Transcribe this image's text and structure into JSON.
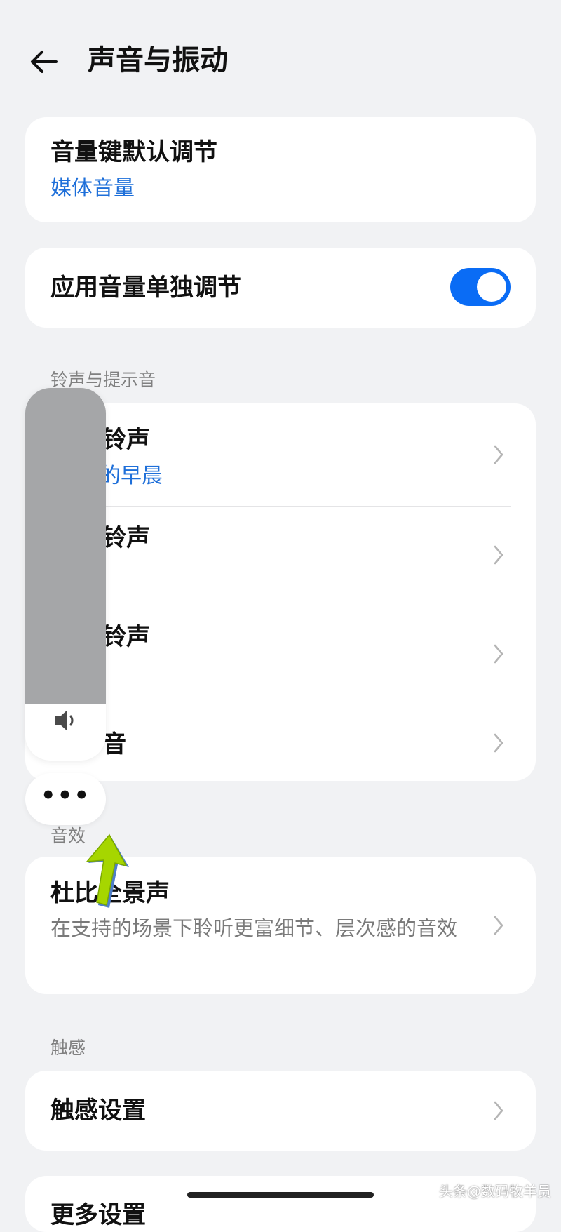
{
  "header": {
    "title": "声音与振动",
    "back_icon": "arrow-left-icon"
  },
  "volume_key": {
    "label": "音量键默认调节",
    "value": "媒体音量"
  },
  "app_volume": {
    "label": "应用音量单独调节",
    "enabled": true
  },
  "ringtones": {
    "section_label": "铃声与提示音",
    "items": [
      {
        "label": "铃声",
        "value": "的早晨"
      },
      {
        "label": "铃声"
      },
      {
        "label": "铃声"
      },
      {
        "label": "音"
      }
    ]
  },
  "sound_effects": {
    "section_label": "音效",
    "dolby": {
      "label": "杜比全景声",
      "description": "在支持的场景下聆听更富细节、层次感的音效"
    }
  },
  "haptics": {
    "section_label": "触感",
    "settings_label": "触感设置"
  },
  "more_card": {
    "label": "更多设置"
  },
  "volume_overlay": {
    "level": 0.85,
    "speaker_icon": "speaker-icon",
    "more_label": "•••"
  },
  "annotation": {
    "arrow_color": "#a6d600",
    "arrow_icon": "up-arrow-icon"
  },
  "watermark": "头条@数码牧羊员",
  "colors": {
    "accent": "#1e6fd9",
    "toggle_on": "#0a6cf5",
    "background": "#f1f2f4"
  }
}
